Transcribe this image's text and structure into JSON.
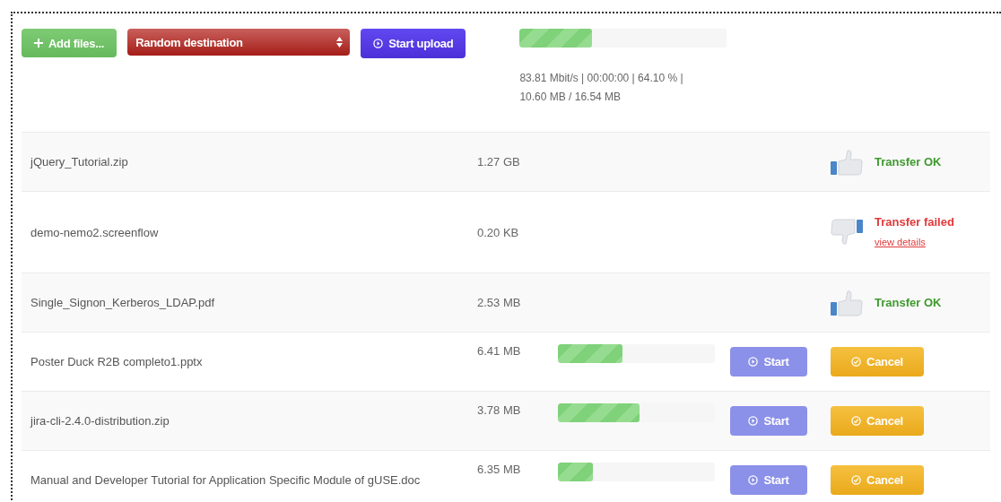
{
  "toolbar": {
    "add_button": {
      "label": "Add files..."
    },
    "destination": {
      "value": "Random destination"
    },
    "start_button": {
      "label": "Start upload"
    },
    "progress": {
      "level": 0.35
    },
    "stats": "83.81 Mbit/s | 00:00:00 | 64.10 % | 10.60 MB / 16.54 MB"
  },
  "files": [
    {
      "name": "jQuery_Tutorial.zip",
      "size": "1.27 GB",
      "kind": "done",
      "success": true,
      "status_text": "Transfer OK"
    },
    {
      "name": "demo-nemo2.screenflow",
      "size": "0.20 KB",
      "kind": "done",
      "success": false,
      "status_text": "Transfer failed",
      "link": "view details"
    },
    {
      "name": "Single_Signon_Kerberos_LDAP.pdf",
      "size": "2.53 MB",
      "kind": "done",
      "success": true,
      "status_text": "Transfer OK"
    },
    {
      "name": "Poster Duck R2B completo1.pptx",
      "size": "6.41 MB",
      "kind": "pending",
      "level": 0.41,
      "start": "Start",
      "cancel": "Cancel"
    },
    {
      "name": "jira-cli-2.4.0-distribution.zip",
      "size": "3.78 MB",
      "kind": "pending",
      "level": 0.52,
      "start": "Start",
      "cancel": "Cancel"
    },
    {
      "name": "Manual and Developer Tutorial for Application Specific Module of gUSE.doc",
      "size": "6.35 MB",
      "kind": "pending",
      "level": 0.22,
      "start": "Start",
      "cancel": "Cancel"
    }
  ]
}
